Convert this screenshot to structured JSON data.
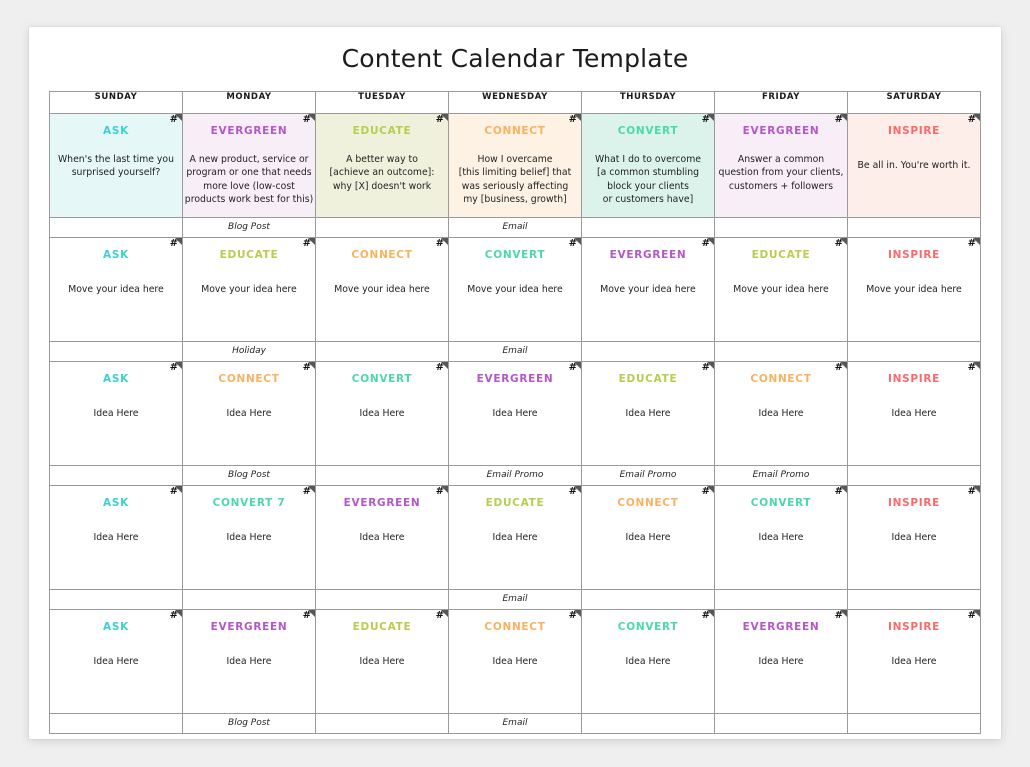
{
  "page": {
    "title": "Content Calendar Template"
  },
  "day_headers": [
    "SUNDAY",
    "MONDAY",
    "TUESDAY",
    "WEDNESDAY",
    "THURSDAY",
    "FRIDAY",
    "SATURDAY"
  ],
  "category_colors": {
    "ASK": "#3ecfd4",
    "EVERGREEN": "#b457c8",
    "EDUCATE": "#b5ce4f",
    "CONNECT": "#f8b25f",
    "CONVERT": "#4ed6ac",
    "INSPIRE": "#fb6a6a"
  },
  "cell_tints": {
    "ASK": "#e6f7f7",
    "EVERGREEN": "#f7eef8",
    "EDUCATE": "#eff1dd",
    "CONNECT": "#fdf2e4",
    "CONVERT": "#dcf3ec",
    "INSPIRE": "#fdeeea",
    "plain": "#ffffff"
  },
  "corner_marker": "#",
  "rows": [
    {
      "cells": [
        {
          "category": "ASK",
          "text": "When's the last time you\nsurprised yourself?",
          "tint": "ASK",
          "marker": true
        },
        {
          "category": "EVERGREEN",
          "text": "A new product, service or\nprogram or one that needs\nmore love (low-cost\nproducts work best for this)",
          "tint": "EVERGREEN",
          "marker": true
        },
        {
          "category": "EDUCATE",
          "text": "A better way to\n[achieve an outcome]:\nwhy [X] doesn't work",
          "tint": "EDUCATE",
          "marker": true
        },
        {
          "category": "CONNECT",
          "text": "How I overcame\n[this limiting belief] that\nwas seriously affecting\nmy [business, growth]",
          "tint": "CONNECT",
          "marker": true
        },
        {
          "category": "CONVERT",
          "text": "What I do to overcome\n[a common stumbling\nblock your clients\nor customers have]",
          "tint": "CONVERT",
          "marker": true
        },
        {
          "category": "EVERGREEN",
          "text": "Answer a common\nquestion from your clients,\ncustomers + followers",
          "tint": "EVERGREEN",
          "marker": true
        },
        {
          "category": "INSPIRE",
          "text": "Be all in. You're worth it.",
          "tint": "INSPIRE",
          "marker": true
        }
      ],
      "notes": [
        "",
        "Blog Post",
        "",
        "Email",
        "",
        "",
        ""
      ]
    },
    {
      "cells": [
        {
          "category": "ASK",
          "text": "Move your idea here",
          "tint": "plain",
          "marker": true
        },
        {
          "category": "EDUCATE",
          "text": "Move your idea here",
          "tint": "plain",
          "marker": true
        },
        {
          "category": "CONNECT",
          "text": "Move your idea here",
          "tint": "plain",
          "marker": true
        },
        {
          "category": "CONVERT",
          "text": "Move your idea here",
          "tint": "plain",
          "marker": true
        },
        {
          "category": "EVERGREEN",
          "text": "Move your idea here",
          "tint": "plain",
          "marker": true
        },
        {
          "category": "EDUCATE",
          "text": "Move your idea here",
          "tint": "plain",
          "marker": true
        },
        {
          "category": "INSPIRE",
          "text": "Move your idea here",
          "tint": "plain",
          "marker": true
        }
      ],
      "notes": [
        "",
        "Holiday",
        "",
        "Email",
        "",
        "",
        ""
      ]
    },
    {
      "cells": [
        {
          "category": "ASK",
          "text": "Idea Here",
          "tint": "plain",
          "marker": true
        },
        {
          "category": "CONNECT",
          "text": "Idea Here",
          "tint": "plain",
          "marker": true
        },
        {
          "category": "CONVERT",
          "text": "Idea Here",
          "tint": "plain",
          "marker": true
        },
        {
          "category": "EVERGREEN",
          "text": "Idea Here",
          "tint": "plain",
          "marker": true
        },
        {
          "category": "EDUCATE",
          "text": "Idea Here",
          "tint": "plain",
          "marker": true
        },
        {
          "category": "CONNECT",
          "text": "Idea Here",
          "tint": "plain",
          "marker": true
        },
        {
          "category": "INSPIRE",
          "text": "Idea Here",
          "tint": "plain",
          "marker": true
        }
      ],
      "notes": [
        "",
        "Blog Post",
        "",
        "Email Promo",
        "Email Promo",
        "Email Promo",
        ""
      ]
    },
    {
      "cells": [
        {
          "category": "ASK",
          "text": "Idea Here",
          "tint": "plain",
          "marker": true
        },
        {
          "category": "CONVERT 7",
          "text": "Idea Here",
          "tint": "plain",
          "marker": true
        },
        {
          "category": "EVERGREEN",
          "text": "Idea Here",
          "tint": "plain",
          "marker": true
        },
        {
          "category": "EDUCATE",
          "text": "Idea Here",
          "tint": "plain",
          "marker": true
        },
        {
          "category": "CONNECT",
          "text": "Idea Here",
          "tint": "plain",
          "marker": true
        },
        {
          "category": "CONVERT",
          "text": "Idea Here",
          "tint": "plain",
          "marker": true
        },
        {
          "category": "INSPIRE",
          "text": "Idea Here",
          "tint": "plain",
          "marker": true
        }
      ],
      "notes": [
        "",
        "",
        "",
        "Email",
        "",
        "",
        ""
      ]
    },
    {
      "cells": [
        {
          "category": "ASK",
          "text": "Idea Here",
          "tint": "plain",
          "marker": true
        },
        {
          "category": "EVERGREEN",
          "text": "Idea Here",
          "tint": "plain",
          "marker": true
        },
        {
          "category": "EDUCATE",
          "text": "Idea Here",
          "tint": "plain",
          "marker": true
        },
        {
          "category": "CONNECT",
          "text": "Idea Here",
          "tint": "plain",
          "marker": true
        },
        {
          "category": "CONVERT",
          "text": "Idea Here",
          "tint": "plain",
          "marker": true
        },
        {
          "category": "EVERGREEN",
          "text": "Idea Here",
          "tint": "plain",
          "marker": true
        },
        {
          "category": "INSPIRE",
          "text": "Idea Here",
          "tint": "plain",
          "marker": true
        }
      ],
      "notes": [
        "",
        "Blog Post",
        "",
        "Email",
        "",
        "",
        ""
      ]
    }
  ]
}
